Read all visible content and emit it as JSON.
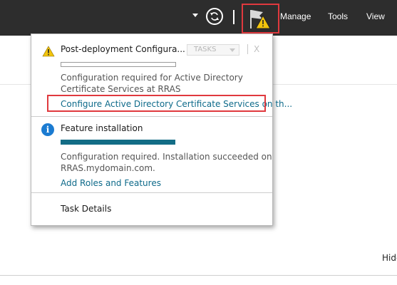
{
  "toolbar": {
    "menus": [
      "Manage",
      "Tools",
      "View"
    ]
  },
  "notifications": {
    "items": [
      {
        "title": "Post-deployment Configura...",
        "tasks_label": "TASKS",
        "close_label": "X",
        "message_line1": "Configuration required for Active Directory",
        "message_line2": "Certificate Services at RRAS",
        "link": "Configure Active Directory Certificate Services on th..."
      },
      {
        "title": "Feature installation",
        "progress": 1.0,
        "message_line1": "Configuration required. Installation succeeded on",
        "message_line2": "RRAS.mydomain.com.",
        "link": "Add Roles and Features"
      }
    ],
    "task_details": "Task Details"
  },
  "page": {
    "hide_label": "Hide"
  },
  "colors": {
    "topbar": "#2d2d2d",
    "highlight": "#e0393e",
    "link": "#0e6a8a",
    "progress": "#136d86"
  }
}
